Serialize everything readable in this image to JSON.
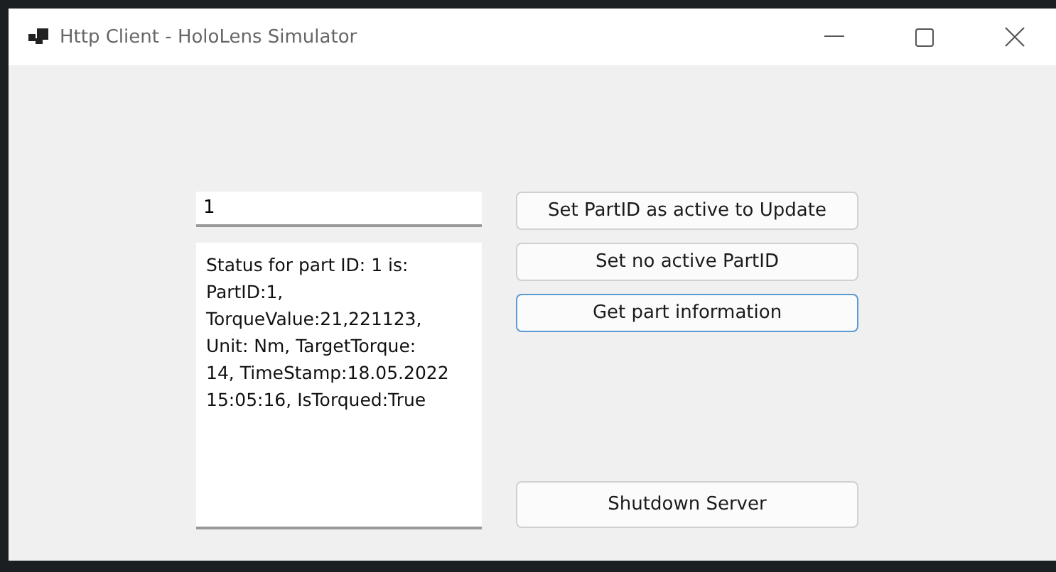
{
  "window": {
    "title": "Http Client - HoloLens Simulator"
  },
  "part_id_field": {
    "value": "1"
  },
  "status_text": "Status for part ID: 1 is:\nPartID:1,\nTorqueValue:21,221123,\nUnit: Nm, TargetTorque:\n14, TimeStamp:18.05.2022\n15:05:16, IsTorqued:True",
  "buttons": [
    {
      "label": "Set PartID as active to Update",
      "focused": false
    },
    {
      "label": "Set no active PartID",
      "focused": false
    },
    {
      "label": "Get part information",
      "focused": true
    },
    {
      "label": "Shutdown Server",
      "focused": false
    }
  ]
}
